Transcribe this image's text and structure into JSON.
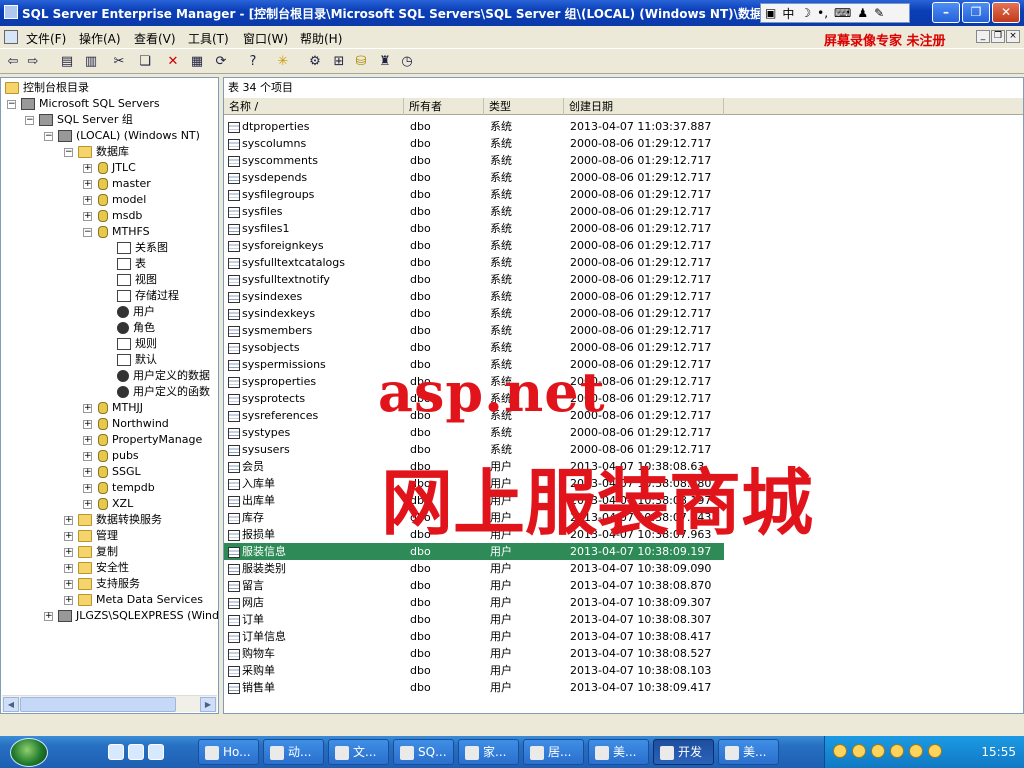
{
  "window": {
    "title": "SQL Server Enterprise Manager - [控制台根目录\\Microsoft SQL Servers\\SQL Server 组\\(LOCAL) (Windows NT)\\数据库\\MTHFS\\表]"
  },
  "ime": {
    "mode_label": "中"
  },
  "menu": {
    "items": [
      "文件(F)",
      "操作(A)",
      "查看(V)",
      "工具(T)",
      "窗口(W)",
      "帮助(H)"
    ]
  },
  "recorder_banner": "屏幕录像专家  未注册",
  "tree": {
    "root": "控制台根目录",
    "servers_group": "Microsoft SQL Servers",
    "sql_group": "SQL Server 组",
    "local_server": "(LOCAL) (Windows NT)",
    "databases_folder": "数据库",
    "databases": [
      "JTLC",
      "master",
      "model",
      "msdb",
      "MTHFS"
    ],
    "mthfs_children": [
      "关系图",
      "表",
      "视图",
      "存储过程",
      "用户",
      "角色",
      "规则",
      "默认",
      "用户定义的数据",
      "用户定义的函数"
    ],
    "databases_after": [
      "MTHJJ",
      "Northwind",
      "PropertyManage",
      "pubs",
      "SSGL",
      "tempdb",
      "XZL"
    ],
    "server_folders": [
      "数据转换服务",
      "管理",
      "复制",
      "安全性",
      "支持服务",
      "Meta Data Services"
    ],
    "express_server": "JLGZS\\SQLEXPRESS (Window"
  },
  "list": {
    "caption": "表    34 个项目",
    "columns": [
      "名称  /",
      "所有者",
      "类型",
      "创建日期"
    ],
    "rows": [
      [
        "dtproperties",
        "dbo",
        "系统",
        "2013-04-07 11:03:37.887"
      ],
      [
        "syscolumns",
        "dbo",
        "系统",
        "2000-08-06 01:29:12.717"
      ],
      [
        "syscomments",
        "dbo",
        "系统",
        "2000-08-06 01:29:12.717"
      ],
      [
        "sysdepends",
        "dbo",
        "系统",
        "2000-08-06 01:29:12.717"
      ],
      [
        "sysfilegroups",
        "dbo",
        "系统",
        "2000-08-06 01:29:12.717"
      ],
      [
        "sysfiles",
        "dbo",
        "系统",
        "2000-08-06 01:29:12.717"
      ],
      [
        "sysfiles1",
        "dbo",
        "系统",
        "2000-08-06 01:29:12.717"
      ],
      [
        "sysforeignkeys",
        "dbo",
        "系统",
        "2000-08-06 01:29:12.717"
      ],
      [
        "sysfulltextcatalogs",
        "dbo",
        "系统",
        "2000-08-06 01:29:12.717"
      ],
      [
        "sysfulltextnotify",
        "dbo",
        "系统",
        "2000-08-06 01:29:12.717"
      ],
      [
        "sysindexes",
        "dbo",
        "系统",
        "2000-08-06 01:29:12.717"
      ],
      [
        "sysindexkeys",
        "dbo",
        "系统",
        "2000-08-06 01:29:12.717"
      ],
      [
        "sysmembers",
        "dbo",
        "系统",
        "2000-08-06 01:29:12.717"
      ],
      [
        "sysobjects",
        "dbo",
        "系统",
        "2000-08-06 01:29:12.717"
      ],
      [
        "syspermissions",
        "dbo",
        "系统",
        "2000-08-06 01:29:12.717"
      ],
      [
        "sysproperties",
        "dbo",
        "系统",
        "2000-08-06 01:29:12.717"
      ],
      [
        "sysprotects",
        "dbo",
        "系统",
        "2000-08-06 01:29:12.717"
      ],
      [
        "sysreferences",
        "dbo",
        "系统",
        "2000-08-06 01:29:12.717"
      ],
      [
        "systypes",
        "dbo",
        "系统",
        "2000-08-06 01:29:12.717"
      ],
      [
        "sysusers",
        "dbo",
        "系统",
        "2000-08-06 01:29:12.717"
      ],
      [
        "会员",
        "dbo",
        "用户",
        "2013-04-07 10:38:08.63"
      ],
      [
        "入库单",
        "dbo",
        "用户",
        "2013-04-07 10:38:08.980"
      ],
      [
        "出库单",
        "dbo",
        "用户",
        "2013-04-07 10:38:08.197"
      ],
      [
        "库存",
        "dbo",
        "用户",
        "2013-04-07 10:38:07.743"
      ],
      [
        "报损单",
        "dbo",
        "用户",
        "2013-04-07 10:38:07.963"
      ],
      [
        "服装信息",
        "dbo",
        "用户",
        "2013-04-07 10:38:09.197"
      ],
      [
        "服装类别",
        "dbo",
        "用户",
        "2013-04-07 10:38:09.090"
      ],
      [
        "留言",
        "dbo",
        "用户",
        "2013-04-07 10:38:08.870"
      ],
      [
        "网店",
        "dbo",
        "用户",
        "2013-04-07 10:38:09.307"
      ],
      [
        "订单",
        "dbo",
        "用户",
        "2013-04-07 10:38:08.307"
      ],
      [
        "订单信息",
        "dbo",
        "用户",
        "2013-04-07 10:38:08.417"
      ],
      [
        "购物车",
        "dbo",
        "用户",
        "2013-04-07 10:38:08.527"
      ],
      [
        "采购单",
        "dbo",
        "用户",
        "2013-04-07 10:38:08.103"
      ],
      [
        "销售单",
        "dbo",
        "用户",
        "2013-04-07 10:38:09.417"
      ]
    ],
    "selected_row": "服装信息"
  },
  "overlay": {
    "line1": "asp.net",
    "line2": "网上服装商城"
  },
  "taskbar": {
    "tasks": [
      "Ho...",
      "动...",
      "文...",
      "SQ...",
      "家...",
      "居...",
      "美...",
      "开发",
      "美..."
    ],
    "active_task": "开发",
    "clock": "15:55"
  }
}
